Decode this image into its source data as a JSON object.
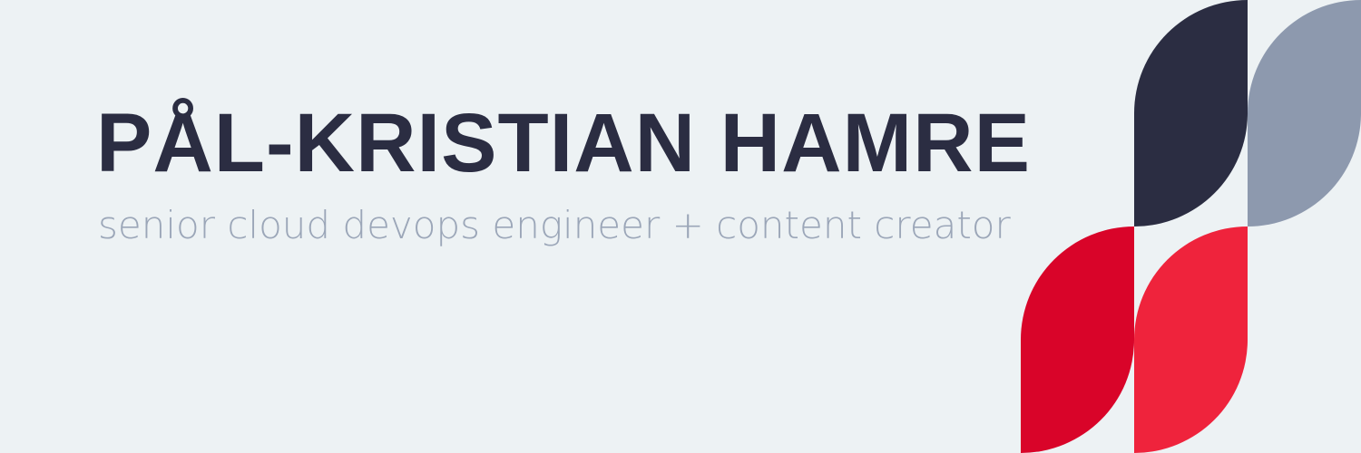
{
  "banner": {
    "name": "PÅL-KRISTIAN HAMRE",
    "tagline": "senior cloud devops engineer + content creator"
  },
  "colors": {
    "background": "#edf2f4",
    "text_dark": "#2b2d42",
    "text_muted": "#8d99ae",
    "shape_navy": "#2b2d42",
    "shape_slate": "#8d99ae",
    "shape_red_dark": "#d90429",
    "shape_red": "#ef233c"
  }
}
